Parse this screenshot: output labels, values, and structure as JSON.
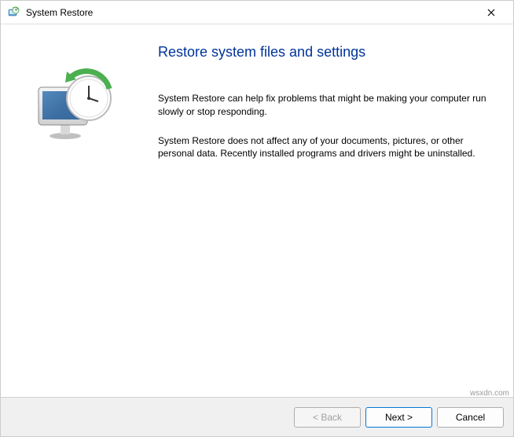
{
  "titlebar": {
    "title": "System Restore"
  },
  "main": {
    "heading": "Restore system files and settings",
    "paragraph1": "System Restore can help fix problems that might be making your computer run slowly or stop responding.",
    "paragraph2": "System Restore does not affect any of your documents, pictures, or other personal data. Recently installed programs and drivers might be uninstalled."
  },
  "footer": {
    "back_label": "< Back",
    "next_label": "Next >",
    "cancel_label": "Cancel"
  },
  "watermark": "wsxdn.com"
}
